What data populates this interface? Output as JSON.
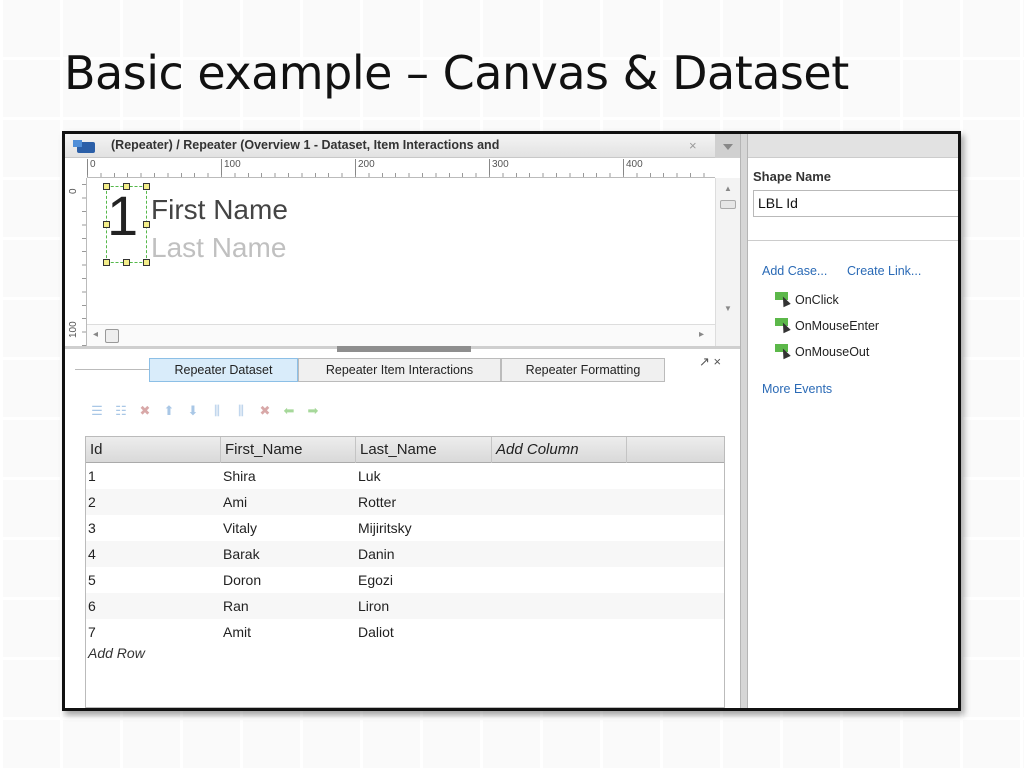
{
  "slide": {
    "title": "Basic example – Canvas & Dataset"
  },
  "canvas": {
    "tab_title": "(Repeater) / Repeater (Overview 1 - Dataset, Item Interactions and",
    "close_glyph": "×",
    "ruler_h_labels": [
      "0",
      "100",
      "200",
      "300",
      "400"
    ],
    "ruler_v_labels": [
      "0",
      "100"
    ],
    "repeater_item": {
      "number": "1",
      "first": "First Name",
      "last": "Last Name"
    }
  },
  "bottom_pane": {
    "tabs": [
      {
        "label": "Repeater Dataset",
        "active": true
      },
      {
        "label": "Repeater Item Interactions",
        "active": false
      },
      {
        "label": "Repeater Formatting",
        "active": false
      }
    ],
    "pane_icons": "↗ ×"
  },
  "dataset": {
    "columns": [
      "Id",
      "First_Name",
      "Last_Name",
      "Add Column"
    ],
    "rows": [
      [
        "1",
        "Shira",
        "Luk"
      ],
      [
        "2",
        "Ami",
        "Rotter"
      ],
      [
        "3",
        "Vitaly",
        "Mijiritsky"
      ],
      [
        "4",
        "Barak",
        "Danin"
      ],
      [
        "5",
        "Doron",
        "Egozi"
      ],
      [
        "6",
        "Ran",
        "Liron"
      ],
      [
        "7",
        "Amit",
        "Daliot"
      ]
    ],
    "add_row": "Add Row"
  },
  "properties": {
    "shape_name_label": "Shape Name",
    "shape_name_value": "LBL Id",
    "add_case": "Add Case...",
    "create_link": "Create Link...",
    "events": [
      "OnClick",
      "OnMouseEnter",
      "OnMouseOut"
    ],
    "more_events": "More Events"
  }
}
